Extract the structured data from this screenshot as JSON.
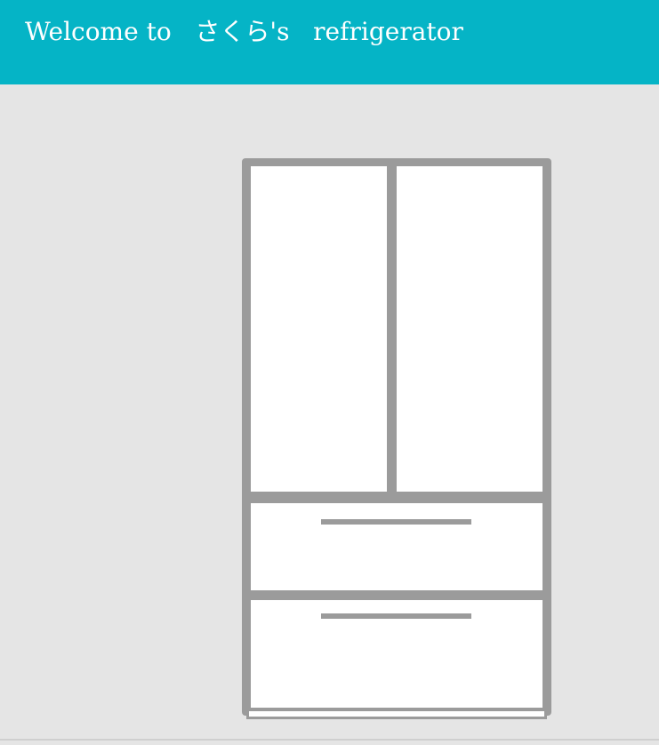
{
  "header": {
    "title": "Welcome to   さくら's   refrigerator"
  },
  "colors": {
    "header_bg": "#05b4c6",
    "page_bg": "#e5e5e5",
    "fridge_frame": "#9b9b9b",
    "fridge_panel": "#ffffff"
  },
  "fridge": {
    "parts": [
      "door-left",
      "door-right",
      "drawer-1",
      "drawer-2"
    ]
  }
}
